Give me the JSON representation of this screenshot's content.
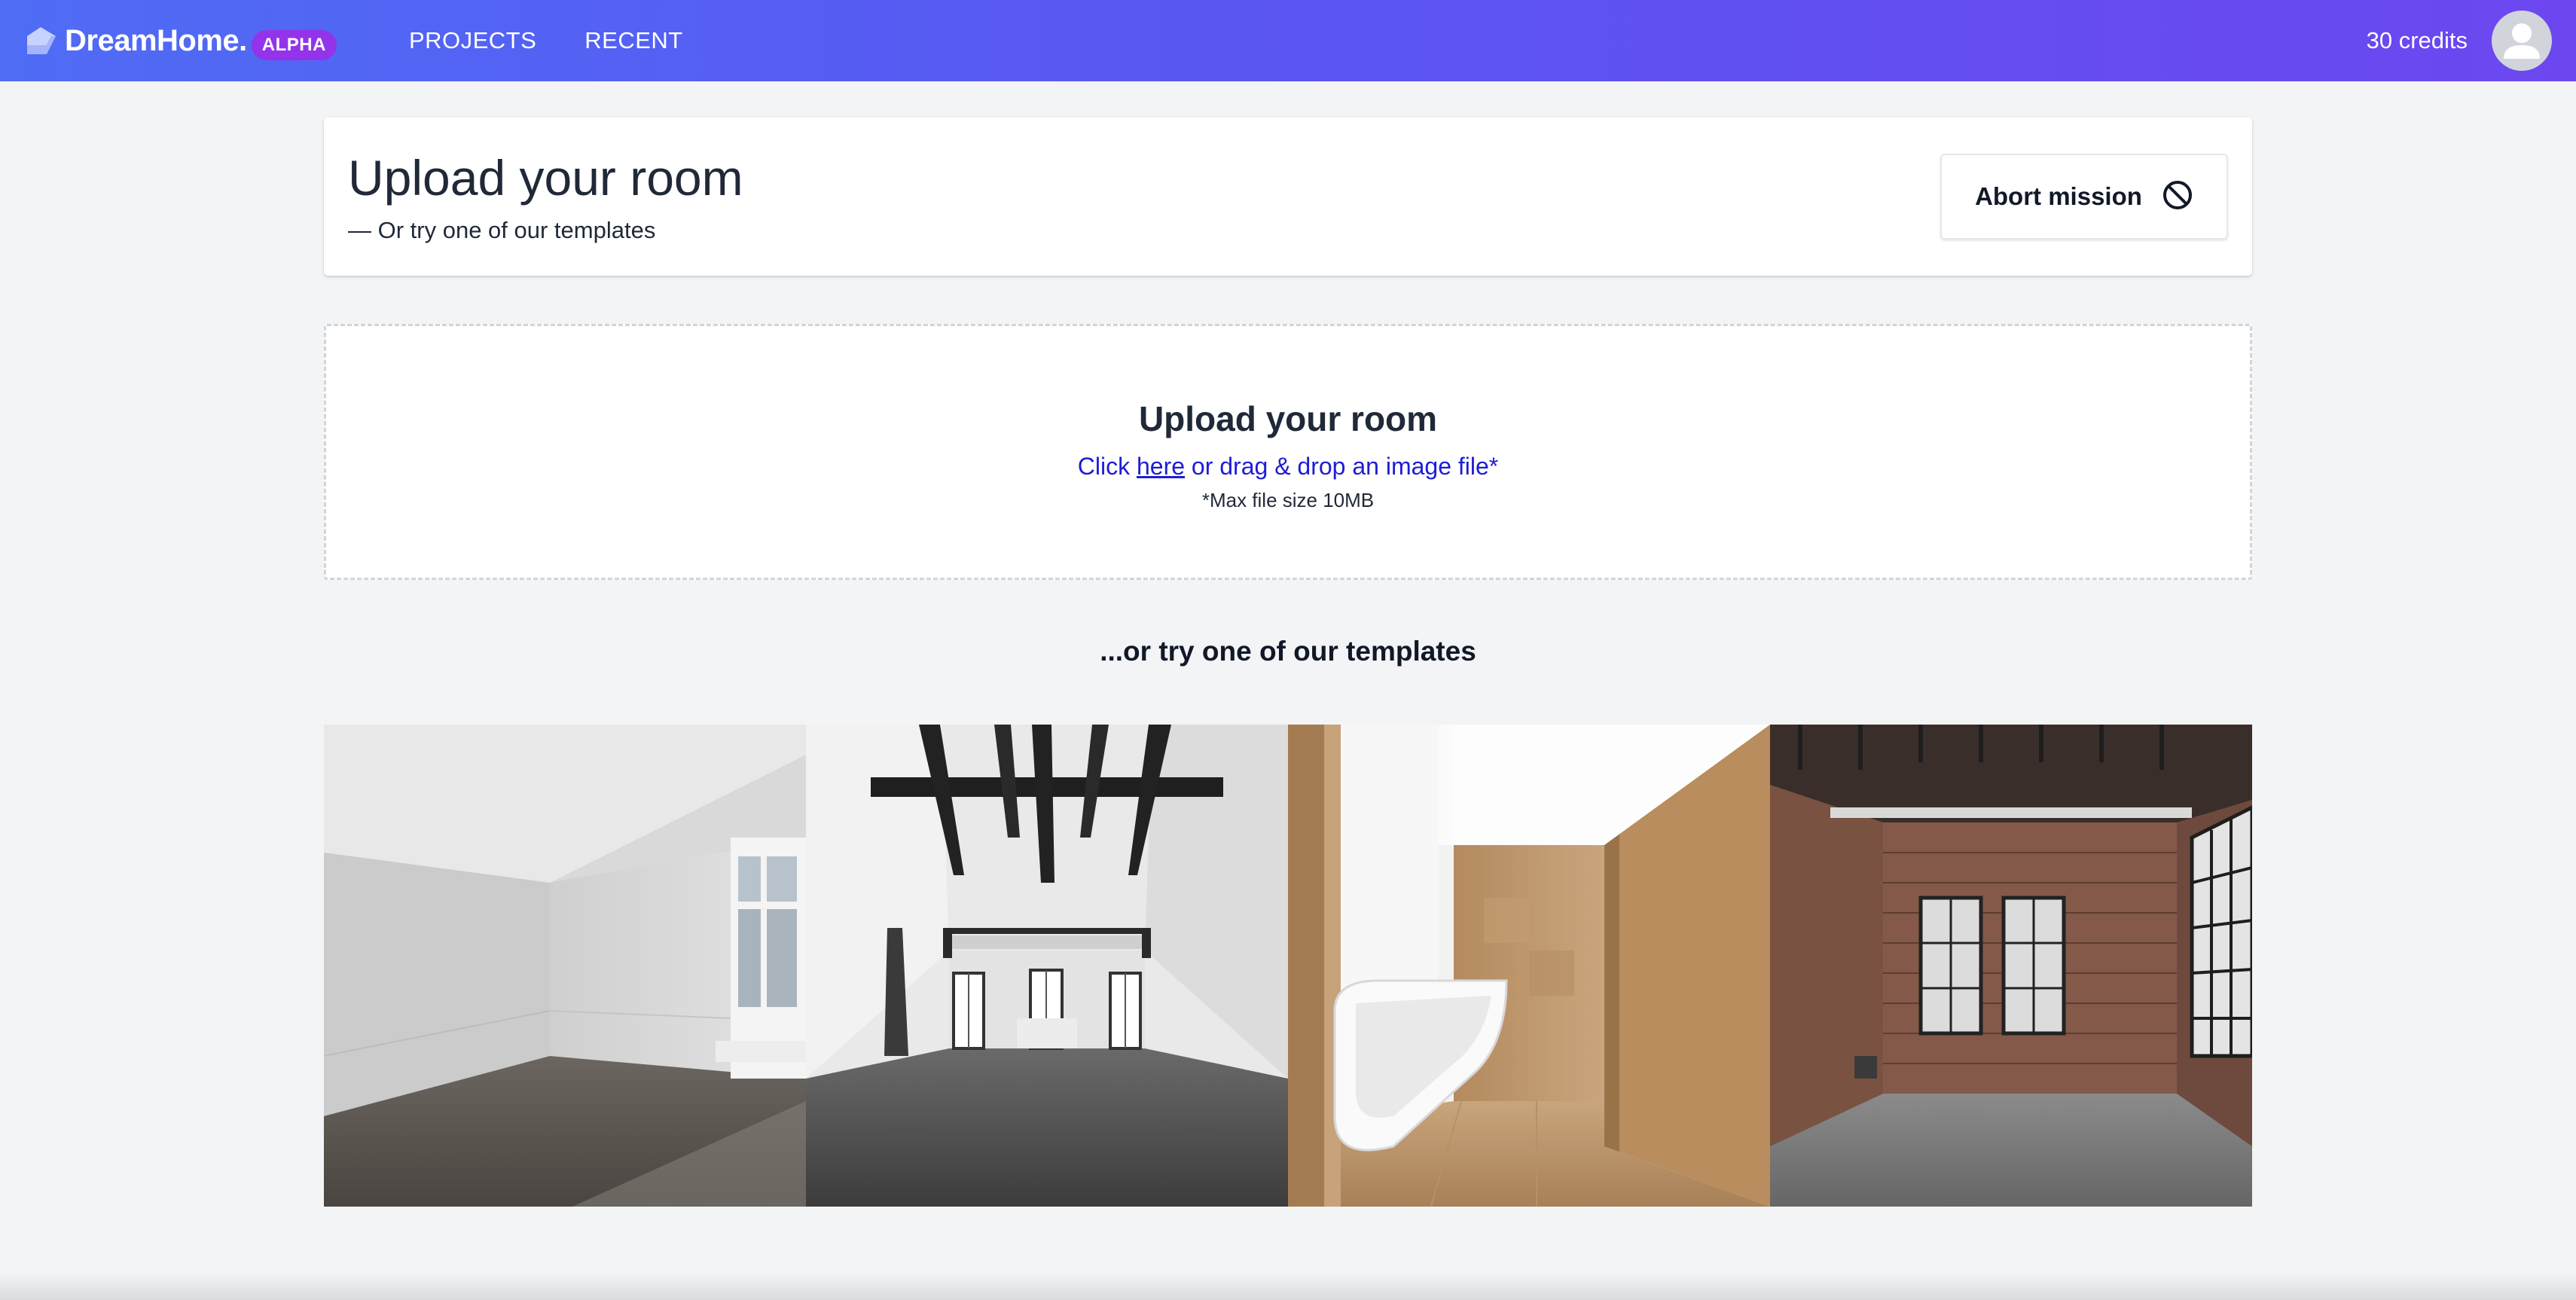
{
  "brand": {
    "name": "DreamHome.",
    "badge": "ALPHA",
    "logo_icon": "house-arrow-icon"
  },
  "nav": {
    "items": [
      {
        "label": "PROJECTS"
      },
      {
        "label": "RECENT"
      }
    ]
  },
  "account": {
    "credits": "30 credits",
    "avatar_icon": "user-avatar-icon"
  },
  "header": {
    "title": "Upload your room",
    "subtitle": "— Or try one of our templates",
    "abort_label": "Abort mission",
    "abort_icon": "prohibited-icon"
  },
  "upload": {
    "title": "Upload your room",
    "instruction_before": "Click ",
    "instruction_link": "here",
    "instruction_after": " or drag & drop an image file*",
    "note": "*Max file size 10MB"
  },
  "templates": {
    "heading": "...or try one of our templates",
    "items": [
      {
        "image": "empty-white-room-wood-floor"
      },
      {
        "image": "attic-room-dark-beams"
      },
      {
        "image": "wood-paneled-bathroom-tub"
      },
      {
        "image": "industrial-brick-loft"
      }
    ]
  },
  "colors": {
    "nav_gradient_start": "#4f6cf5",
    "nav_gradient_end": "#6c47f0",
    "badge": "#9333ea",
    "link": "#1d1dd6",
    "page_bg": "#f3f4f6"
  }
}
